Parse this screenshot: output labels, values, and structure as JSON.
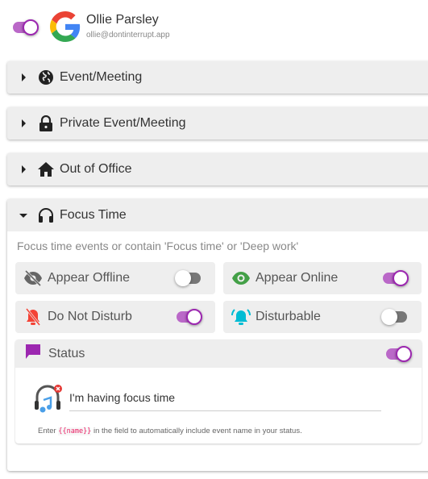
{
  "account": {
    "name": "Ollie Parsley",
    "email": "ollie@dontinterrupt.app",
    "enabled": true
  },
  "sections": [
    {
      "label": "Event/Meeting",
      "icon": "globe-icon",
      "expanded": false
    },
    {
      "label": "Private Event/Meeting",
      "icon": "lock-icon",
      "expanded": false
    },
    {
      "label": "Out of Office",
      "icon": "home-icon",
      "expanded": false
    },
    {
      "label": "Focus Time",
      "icon": "headphones-icon",
      "expanded": true
    }
  ],
  "focus": {
    "description": "Focus time events or contain 'Focus time' or 'Deep work'",
    "options": [
      {
        "label": "Appear Offline",
        "icon": "eye-off-icon",
        "on": false
      },
      {
        "label": "Appear Online",
        "icon": "eye-icon",
        "on": true,
        "color": "#43a047"
      },
      {
        "label": "Do Not Disturb",
        "icon": "bell-off-icon",
        "on": true,
        "color": "#f44336"
      },
      {
        "label": "Disturbable",
        "icon": "bell-ring-icon",
        "on": false,
        "color": "#00bcd4"
      }
    ],
    "status": {
      "label": "Status",
      "on": true,
      "value": "I'm having focus time",
      "hint_before": "Enter",
      "hint_code": "{{name}}",
      "hint_after": "in the field to automatically include event name in your status."
    }
  },
  "colors": {
    "accent": "#ba68c8",
    "status_icon": "#9c27b0"
  }
}
